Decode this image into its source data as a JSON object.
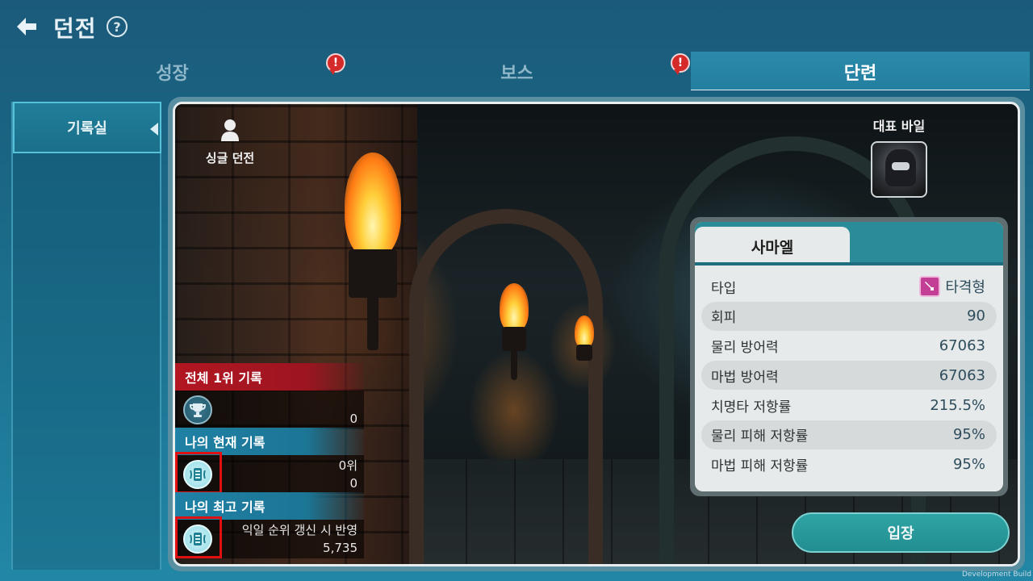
{
  "header": {
    "title": "던전",
    "help_label": "?"
  },
  "tabs": [
    {
      "label": "성장",
      "alert": "!"
    },
    {
      "label": "보스",
      "alert": "!"
    },
    {
      "label": "단련"
    }
  ],
  "sidebar": {
    "items": [
      {
        "label": "기록실"
      }
    ]
  },
  "main": {
    "mode_label": "싱글 던전",
    "representative": {
      "label": "대표 바일"
    },
    "stats_card": {
      "name": "사마엘",
      "rows": [
        {
          "label": "타입",
          "value": "타격형"
        },
        {
          "label": "회피",
          "value": "90"
        },
        {
          "label": "물리 방어력",
          "value": "67063"
        },
        {
          "label": "마법 방어력",
          "value": "67063"
        },
        {
          "label": "치명타 저항률",
          "value": "215.5%"
        },
        {
          "label": "물리 피해 저항률",
          "value": "95%"
        },
        {
          "label": "마법 피해 저항률",
          "value": "95%"
        }
      ]
    },
    "enter_button": "입장",
    "records": {
      "overall_top": {
        "title": "전체 1위 기록",
        "score": "0"
      },
      "my_current": {
        "title": "나의 현재 기록",
        "rank": "0위",
        "score": "0"
      },
      "my_best": {
        "title": "나의 최고 기록",
        "note": "익일 순위 갱신 시 반영",
        "score": "5,735"
      }
    }
  },
  "footer": {
    "dev_build": "Development Build"
  },
  "colors": {
    "accent_teal": "#2a8c98",
    "red_header": "#b21621",
    "blue_header": "#1f81a5",
    "alert_red": "#d52a2a",
    "highlight_red": "#e01010"
  }
}
